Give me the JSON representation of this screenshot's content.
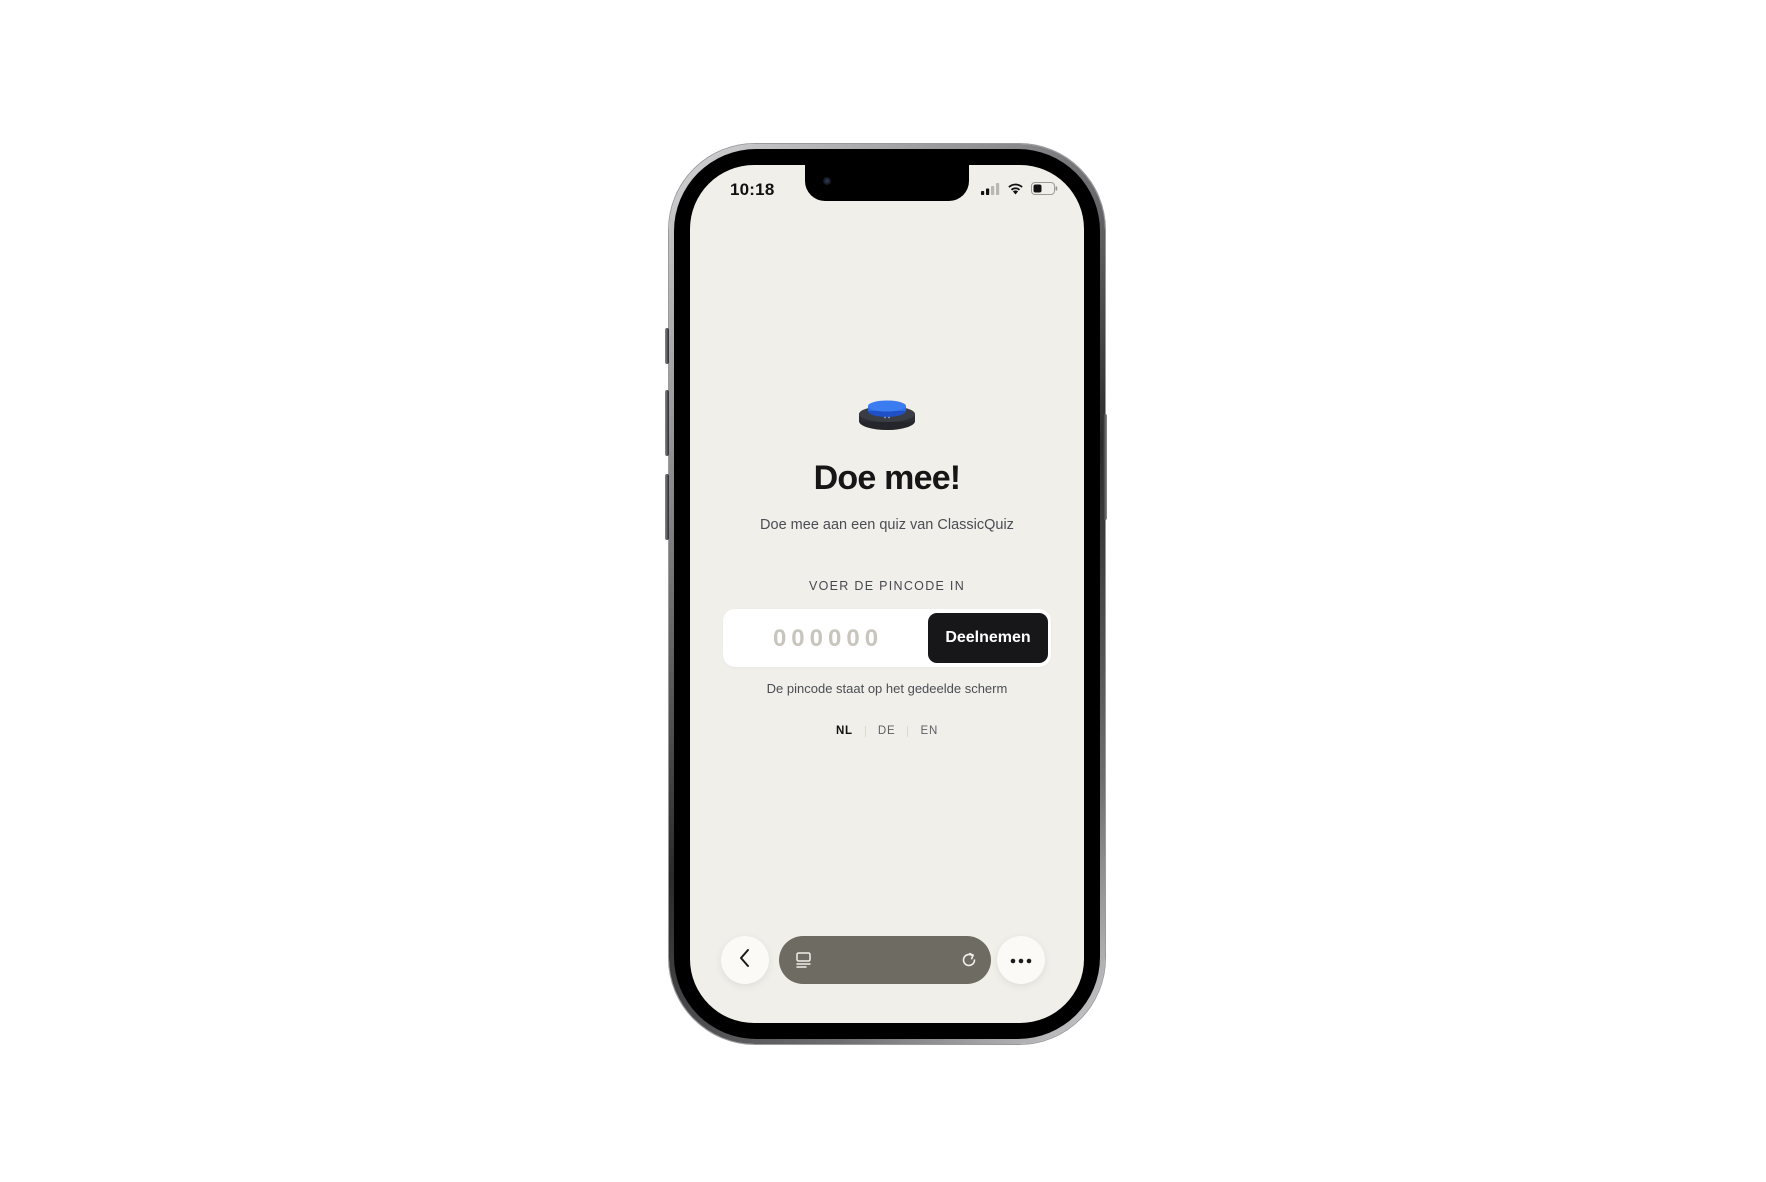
{
  "status_bar": {
    "time": "10:18",
    "icons": [
      "cellular-signal-icon",
      "wifi-icon",
      "battery-icon"
    ]
  },
  "main": {
    "logo": "buzzer-icon",
    "title": "Doe mee!",
    "subtitle": "Doe mee aan een quiz van ClassicQuiz",
    "pin_label": "VOER DE PINCODE IN",
    "pin_input": {
      "value": "",
      "placeholder": "000000"
    },
    "join_button_label": "Deelnemen",
    "helper_text": "De pincode staat op het gedeelde scherm",
    "languages": [
      {
        "code": "NL",
        "active": true
      },
      {
        "code": "DE",
        "active": false
      },
      {
        "code": "EN",
        "active": false
      }
    ]
  },
  "browser_bar": {
    "back": "chevron-left-icon",
    "url_text": "",
    "tabs": "tabs-icon",
    "reload": "reload-icon",
    "more": "more-dots-icon"
  },
  "colors": {
    "screen_background": "#f1efe9",
    "button": "#17171a",
    "url_pill": "#6e6b62",
    "buzzer_top": "#2f6be0",
    "buzzer_base": "#2b2d33"
  }
}
